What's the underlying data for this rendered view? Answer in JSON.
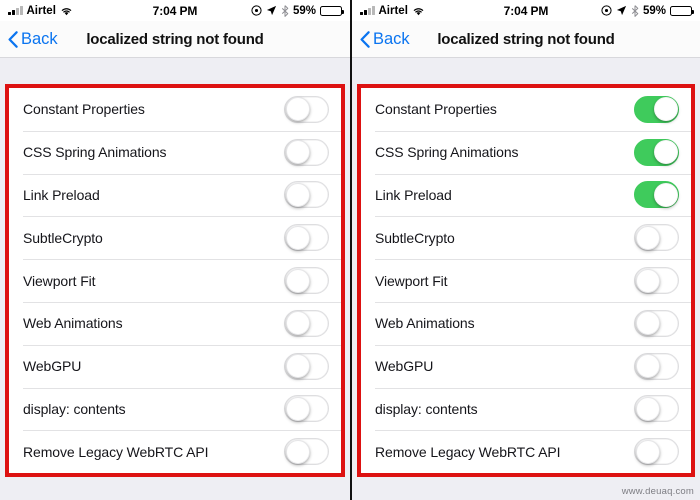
{
  "status_bar": {
    "carrier": "Airtel",
    "time": "7:04 PM",
    "battery_percent": "59%",
    "icons": [
      "signal-bars-icon",
      "wifi-icon",
      "alarm-icon",
      "location-arrow-icon",
      "bluetooth-icon",
      "battery-icon"
    ]
  },
  "nav": {
    "back_label": "Back",
    "title": "localized string not found"
  },
  "settings_rows": [
    "Constant Properties",
    "CSS Spring Animations",
    "Link Preload",
    "SubtleCrypto",
    "Viewport Fit",
    "Web Animations",
    "WebGPU",
    "display: contents",
    "Remove Legacy WebRTC API"
  ],
  "panels": [
    {
      "id": "left",
      "caption": "all-toggles-off",
      "toggles": [
        false,
        false,
        false,
        false,
        false,
        false,
        false,
        false,
        false
      ]
    },
    {
      "id": "right",
      "caption": "first-three-toggles-on",
      "toggles": [
        true,
        true,
        true,
        false,
        false,
        false,
        false,
        false,
        false
      ]
    }
  ],
  "watermark": "www.deuaq.com",
  "colors": {
    "accent_blue": "#0a74f0",
    "toggle_on_green": "#3fcb5c",
    "highlight_red": "#dd1111",
    "list_background": "#eeeef3",
    "separator": "#e2e2e4"
  }
}
